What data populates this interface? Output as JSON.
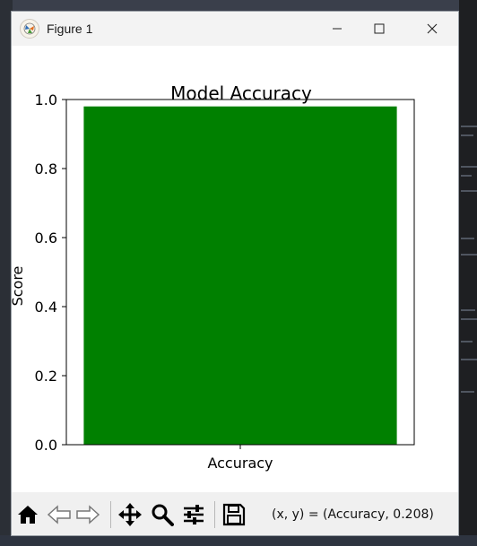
{
  "window": {
    "title": "Figure 1"
  },
  "toolbar": {
    "coords_text": "(x, y) = (Accuracy, 0.208)",
    "tools": [
      "home-icon",
      "back-icon",
      "forward-icon",
      "pan-icon",
      "zoom-icon",
      "configure-subplots-icon",
      "save-icon"
    ]
  },
  "chart_data": {
    "type": "bar",
    "title": "Model Accuracy",
    "xlabel": "",
    "ylabel": "Score",
    "categories": [
      "Accuracy"
    ],
    "values": [
      0.98
    ],
    "ylim": [
      0,
      1.0
    ],
    "yticks": [
      "0.0",
      "0.2",
      "0.4",
      "0.6",
      "0.8",
      "1.0"
    ],
    "bar_color": "#008000",
    "grid": false
  },
  "colors": {
    "bar": "#008000",
    "titlebar": "#f3f3f3",
    "toolbar": "#f0f0f0"
  }
}
